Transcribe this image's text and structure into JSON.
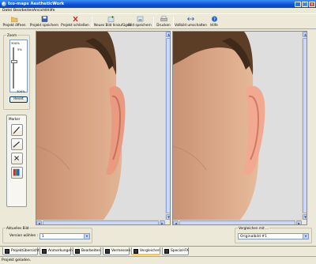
{
  "window": {
    "title": "Ixo-maps AestheticWork"
  },
  "menu": [
    "Datei",
    "Bearbeiten",
    "Ansicht",
    "Hilfe"
  ],
  "toolbar": [
    {
      "label": "Projekt öffnen",
      "icon": "folder-open-icon"
    },
    {
      "label": "Projekt speichern",
      "icon": "save-icon"
    },
    {
      "label": "Projekt schließen",
      "icon": "close-project-icon"
    },
    {
      "label": "Neues Bild hinzufügen",
      "icon": "add-image-icon"
    },
    {
      "label": "Bild speichern",
      "icon": "save-image-icon"
    },
    {
      "label": "Drucken",
      "icon": "print-icon"
    },
    {
      "label": "Vollbild umschalten",
      "icon": "fullscreen-icon"
    },
    {
      "label": "Hilfe",
      "icon": "help-icon"
    }
  ],
  "zoom": {
    "label": "Zoom",
    "top": "300%",
    "mid": "5%",
    "bottom": "300%",
    "reset": "Reset"
  },
  "marker": {
    "label": "Marker"
  },
  "current_image": {
    "label": "Aktuelles Bild",
    "version_label": "Version wählen :",
    "value": "1"
  },
  "compare": {
    "label": "Vergleichen mit ...",
    "value": "Originalbild #1"
  },
  "tabs": [
    "Projektübersicht",
    "Anmerkungen",
    "Bearbeiten",
    "Vermessen",
    "Vergleichen",
    "Special-FX"
  ],
  "active_tab": "Vergleichen",
  "status": "Projekt geladen.",
  "colors": {
    "titlebar": "#0a4fd6",
    "skin": "#d8a381",
    "hair": "#5a3d26",
    "ear": "#f1a991"
  }
}
